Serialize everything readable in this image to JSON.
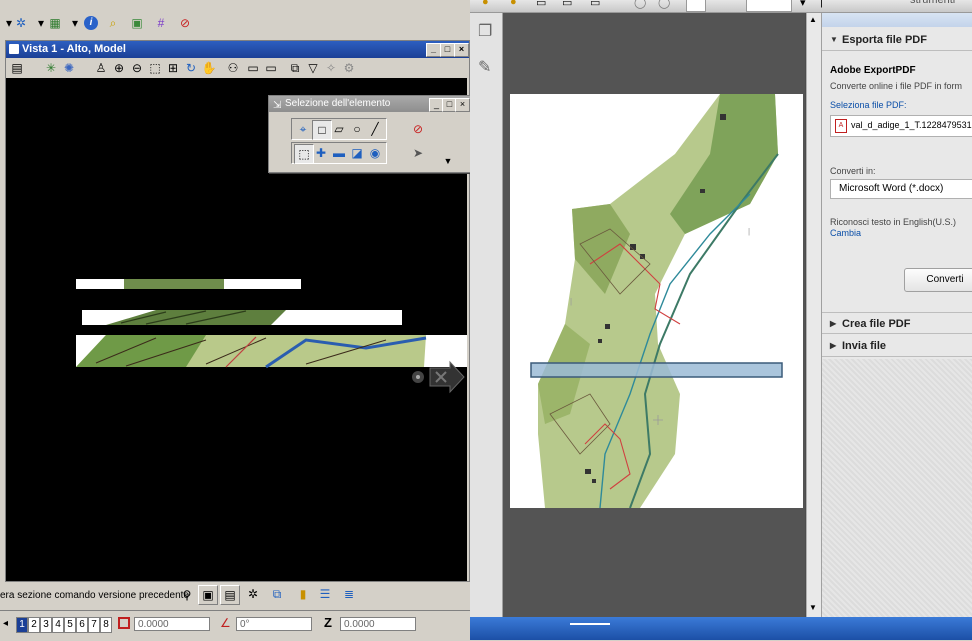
{
  "microstation": {
    "view_window": {
      "title": "Vista 1 - Alto, Model",
      "minimize": "_",
      "restore": "□",
      "close": "×"
    },
    "selection_palette": {
      "title": "Selezione dell'elemento"
    },
    "status_text": "era sezione comando versione precedente",
    "view_buttons": [
      "1",
      "2",
      "3",
      "4",
      "5",
      "6",
      "7",
      "8"
    ],
    "coordinates": {
      "x_value": "0.0000",
      "angle_value": "0°",
      "z_label": "Z",
      "z_value": "0.0000"
    }
  },
  "acrobat": {
    "pane": {
      "export_header": "Esporta file PDF",
      "service_name": "Adobe ExportPDF",
      "service_desc": "Converte online i file PDF in form",
      "select_label": "Seleziona file PDF:",
      "file_name": "val_d_adige_1_T.1228479531",
      "convert_to_label": "Converti in:",
      "convert_to_value": "Microsoft Word (*.docx)",
      "ocr_text": "Riconosci testo in English(U.S.)",
      "change_link": "Cambia",
      "convert_button": "Converti",
      "create_header": "Crea file PDF",
      "send_header": "Invia file"
    },
    "top_right_label": "strumenti"
  },
  "colors": {
    "title_blue": "#1b3f96",
    "canvas_black": "#000000",
    "selection_fill": "#9bbbd6",
    "link_blue": "#0b4fa8",
    "taskbar_blue": "#1c4fa6"
  }
}
